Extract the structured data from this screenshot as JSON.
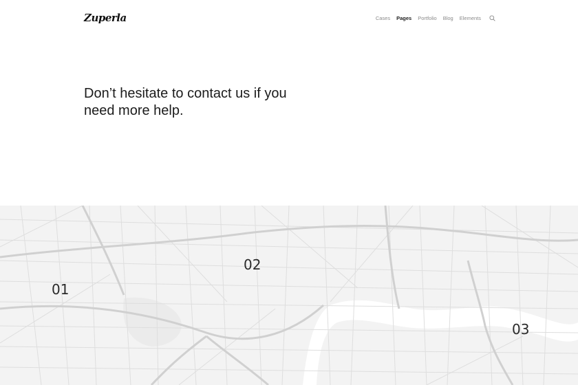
{
  "header": {
    "logo": "Zuperla",
    "nav": [
      "Cases",
      "Pages",
      "Portfolio",
      "Blog",
      "Elements"
    ],
    "active_nav": "Pages"
  },
  "hero": {
    "heading": "Don’t hesitate to contact us if you need more help."
  },
  "map": {
    "pins": [
      "01",
      "02",
      "03"
    ],
    "colors": {
      "land": "#f3f3f3",
      "road": "#dcdcdc",
      "major_road": "#d2d2d2",
      "river": "#ffffff"
    }
  }
}
